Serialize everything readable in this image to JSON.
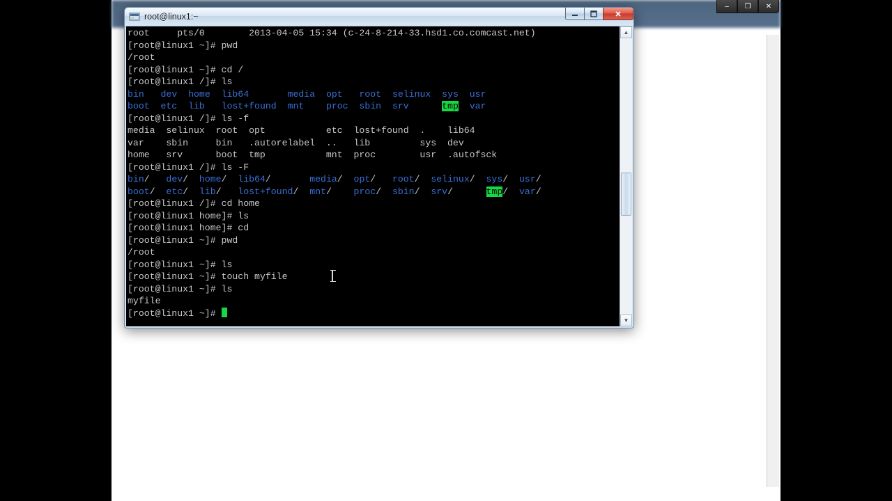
{
  "bg_window": {
    "min_tip": "–",
    "max_tip": "❐",
    "close_tip": "✕"
  },
  "terminal": {
    "title": "root@linux1:~",
    "login_line": "root     pts/0        2013-04-05 15:34 (c-24-8-214-33.hsd1.co.comcast.net)",
    "prompts": {
      "home": "[root@linux1 ~]# ",
      "root": "[root@linux1 /]# ",
      "homedir": "[root@linux1 home]# "
    },
    "commands": {
      "pwd": "pwd",
      "cdroot": "cd /",
      "ls": "ls",
      "lsf": "ls -f",
      "lsF": "ls -F",
      "cdhome": "cd home",
      "cd": "cd",
      "touch": "touch myfile"
    },
    "outputs": {
      "pwd_home": "/root",
      "ls_root_dirs": [
        "bin",
        "dev",
        "home",
        "lib64",
        "media",
        "opt",
        "root",
        "selinux",
        "sys",
        "usr",
        "boot",
        "etc",
        "lib",
        "lost+found",
        "mnt",
        "proc",
        "sbin",
        "srv",
        "tmp",
        "var"
      ],
      "lsf_line1": "media  selinux  root  opt           etc  lost+found  .    lib64",
      "lsf_line2": "var    sbin     bin   .autorelabel  ..   lib         sys  dev",
      "lsf_line3": "home   srv      boot  tmp           mnt  proc        usr  .autofsck",
      "lsF_dirs": [
        "bin",
        "dev",
        "home",
        "lib64",
        "media",
        "opt",
        "root",
        "selinux",
        "sys",
        "usr",
        "boot",
        "etc",
        "lib",
        "lost+found",
        "mnt",
        "proc",
        "sbin",
        "srv",
        "tmp",
        "var"
      ],
      "myfile": "myfile"
    }
  }
}
